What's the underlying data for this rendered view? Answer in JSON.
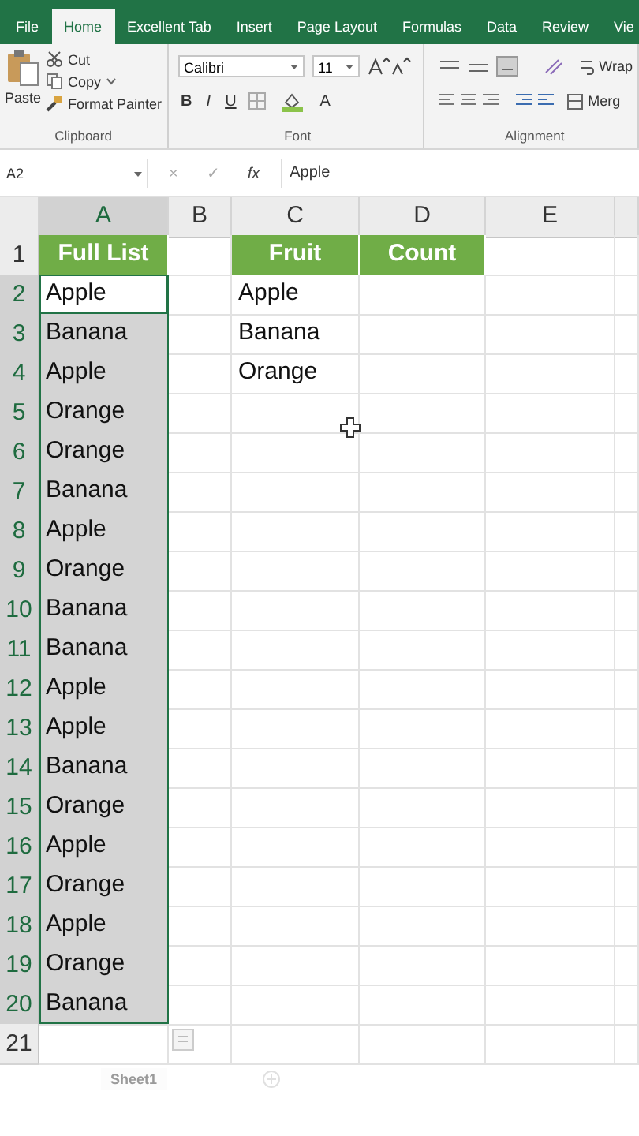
{
  "ribbon_tabs": [
    {
      "label": "File",
      "selected": false
    },
    {
      "label": "Home",
      "selected": true
    },
    {
      "label": "Excellent Tab",
      "selected": false
    },
    {
      "label": "Insert",
      "selected": false
    },
    {
      "label": "Page Layout",
      "selected": false
    },
    {
      "label": "Formulas",
      "selected": false
    },
    {
      "label": "Data",
      "selected": false
    },
    {
      "label": "Review",
      "selected": false
    },
    {
      "label": "Vie",
      "selected": false
    }
  ],
  "clipboard": {
    "paste": "Paste",
    "cut": "Cut",
    "copy": "Copy",
    "format_painter": "Format Painter",
    "label": "Clipboard"
  },
  "font": {
    "name": "Calibri",
    "size": "11",
    "bold": "B",
    "italic": "I",
    "underline": "U",
    "font_color": "A",
    "label": "Font"
  },
  "alignment": {
    "wrap": "Wrap",
    "merge": "Merg",
    "label": "Alignment"
  },
  "formula_bar": {
    "name_box": "A2",
    "cancel": "×",
    "enter": "✓",
    "fx": "fx",
    "value": "Apple"
  },
  "columns": [
    {
      "label": "A",
      "selected": true
    },
    {
      "label": "B",
      "selected": false
    },
    {
      "label": "C",
      "selected": false
    },
    {
      "label": "D",
      "selected": false
    },
    {
      "label": "E",
      "selected": false
    }
  ],
  "rows": [
    {
      "num": "1",
      "selected": false,
      "cells": [
        {
          "kind": "header",
          "text": "Full List",
          "selected": false
        },
        {
          "kind": "empty"
        },
        {
          "kind": "header",
          "text": "Fruit",
          "selected": false
        },
        {
          "kind": "header",
          "text": "Count",
          "selected": false
        },
        {
          "kind": "empty"
        }
      ]
    },
    {
      "num": "2",
      "selected": true,
      "cells": [
        {
          "kind": "text",
          "text": "Apple",
          "active": true
        },
        {
          "kind": "empty"
        },
        {
          "kind": "text",
          "text": "Apple",
          "selected": false
        },
        {
          "kind": "empty"
        },
        {
          "kind": "empty"
        }
      ]
    },
    {
      "num": "3",
      "selected": true,
      "cells": [
        {
          "kind": "text",
          "text": "Banana",
          "selected": true
        },
        {
          "kind": "empty"
        },
        {
          "kind": "text",
          "text": "Banana",
          "selected": false
        },
        {
          "kind": "empty"
        },
        {
          "kind": "empty"
        }
      ]
    },
    {
      "num": "4",
      "selected": true,
      "cells": [
        {
          "kind": "text",
          "text": "Apple",
          "selected": true
        },
        {
          "kind": "empty"
        },
        {
          "kind": "text",
          "text": "Orange",
          "selected": false
        },
        {
          "kind": "empty"
        },
        {
          "kind": "empty"
        }
      ]
    },
    {
      "num": "5",
      "selected": true,
      "cells": [
        {
          "kind": "text",
          "text": "Orange",
          "selected": true
        },
        {
          "kind": "empty"
        },
        {
          "kind": "empty"
        },
        {
          "kind": "empty"
        },
        {
          "kind": "empty"
        }
      ]
    },
    {
      "num": "6",
      "selected": true,
      "cells": [
        {
          "kind": "text",
          "text": "Orange",
          "selected": true
        },
        {
          "kind": "empty"
        },
        {
          "kind": "empty"
        },
        {
          "kind": "empty"
        },
        {
          "kind": "empty"
        }
      ]
    },
    {
      "num": "7",
      "selected": true,
      "cells": [
        {
          "kind": "text",
          "text": "Banana",
          "selected": true
        },
        {
          "kind": "empty"
        },
        {
          "kind": "empty"
        },
        {
          "kind": "empty"
        },
        {
          "kind": "empty"
        }
      ]
    },
    {
      "num": "8",
      "selected": true,
      "cells": [
        {
          "kind": "text",
          "text": "Apple",
          "selected": true
        },
        {
          "kind": "empty"
        },
        {
          "kind": "empty"
        },
        {
          "kind": "empty"
        },
        {
          "kind": "empty"
        }
      ]
    },
    {
      "num": "9",
      "selected": true,
      "cells": [
        {
          "kind": "text",
          "text": "Orange",
          "selected": true
        },
        {
          "kind": "empty"
        },
        {
          "kind": "empty"
        },
        {
          "kind": "empty"
        },
        {
          "kind": "empty"
        }
      ]
    },
    {
      "num": "10",
      "selected": true,
      "cells": [
        {
          "kind": "text",
          "text": "Banana",
          "selected": true
        },
        {
          "kind": "empty"
        },
        {
          "kind": "empty"
        },
        {
          "kind": "empty"
        },
        {
          "kind": "empty"
        }
      ]
    },
    {
      "num": "11",
      "selected": true,
      "cells": [
        {
          "kind": "text",
          "text": "Banana",
          "selected": true
        },
        {
          "kind": "empty"
        },
        {
          "kind": "empty"
        },
        {
          "kind": "empty"
        },
        {
          "kind": "empty"
        }
      ]
    },
    {
      "num": "12",
      "selected": true,
      "cells": [
        {
          "kind": "text",
          "text": "Apple",
          "selected": true
        },
        {
          "kind": "empty"
        },
        {
          "kind": "empty"
        },
        {
          "kind": "empty"
        },
        {
          "kind": "empty"
        }
      ]
    },
    {
      "num": "13",
      "selected": true,
      "cells": [
        {
          "kind": "text",
          "text": "Apple",
          "selected": true
        },
        {
          "kind": "empty"
        },
        {
          "kind": "empty"
        },
        {
          "kind": "empty"
        },
        {
          "kind": "empty"
        }
      ]
    },
    {
      "num": "14",
      "selected": true,
      "cells": [
        {
          "kind": "text",
          "text": "Banana",
          "selected": true
        },
        {
          "kind": "empty"
        },
        {
          "kind": "empty"
        },
        {
          "kind": "empty"
        },
        {
          "kind": "empty"
        }
      ]
    },
    {
      "num": "15",
      "selected": true,
      "cells": [
        {
          "kind": "text",
          "text": "Orange",
          "selected": true
        },
        {
          "kind": "empty"
        },
        {
          "kind": "empty"
        },
        {
          "kind": "empty"
        },
        {
          "kind": "empty"
        }
      ]
    },
    {
      "num": "16",
      "selected": true,
      "cells": [
        {
          "kind": "text",
          "text": "Apple",
          "selected": true
        },
        {
          "kind": "empty"
        },
        {
          "kind": "empty"
        },
        {
          "kind": "empty"
        },
        {
          "kind": "empty"
        }
      ]
    },
    {
      "num": "17",
      "selected": true,
      "cells": [
        {
          "kind": "text",
          "text": "Orange",
          "selected": true
        },
        {
          "kind": "empty"
        },
        {
          "kind": "empty"
        },
        {
          "kind": "empty"
        },
        {
          "kind": "empty"
        }
      ]
    },
    {
      "num": "18",
      "selected": true,
      "cells": [
        {
          "kind": "text",
          "text": "Apple",
          "selected": true
        },
        {
          "kind": "empty"
        },
        {
          "kind": "empty"
        },
        {
          "kind": "empty"
        },
        {
          "kind": "empty"
        }
      ]
    },
    {
      "num": "19",
      "selected": true,
      "cells": [
        {
          "kind": "text",
          "text": "Orange",
          "selected": true
        },
        {
          "kind": "empty"
        },
        {
          "kind": "empty"
        },
        {
          "kind": "empty"
        },
        {
          "kind": "empty"
        }
      ]
    },
    {
      "num": "20",
      "selected": true,
      "cells": [
        {
          "kind": "text",
          "text": "Banana",
          "selected": true
        },
        {
          "kind": "empty"
        },
        {
          "kind": "empty"
        },
        {
          "kind": "empty"
        },
        {
          "kind": "empty"
        }
      ]
    },
    {
      "num": "21",
      "selected": false,
      "cells": [
        {
          "kind": "empty"
        },
        {
          "kind": "quick_analysis"
        },
        {
          "kind": "empty"
        },
        {
          "kind": "empty"
        },
        {
          "kind": "empty"
        }
      ]
    }
  ],
  "sheet_tab": "Sheet1"
}
